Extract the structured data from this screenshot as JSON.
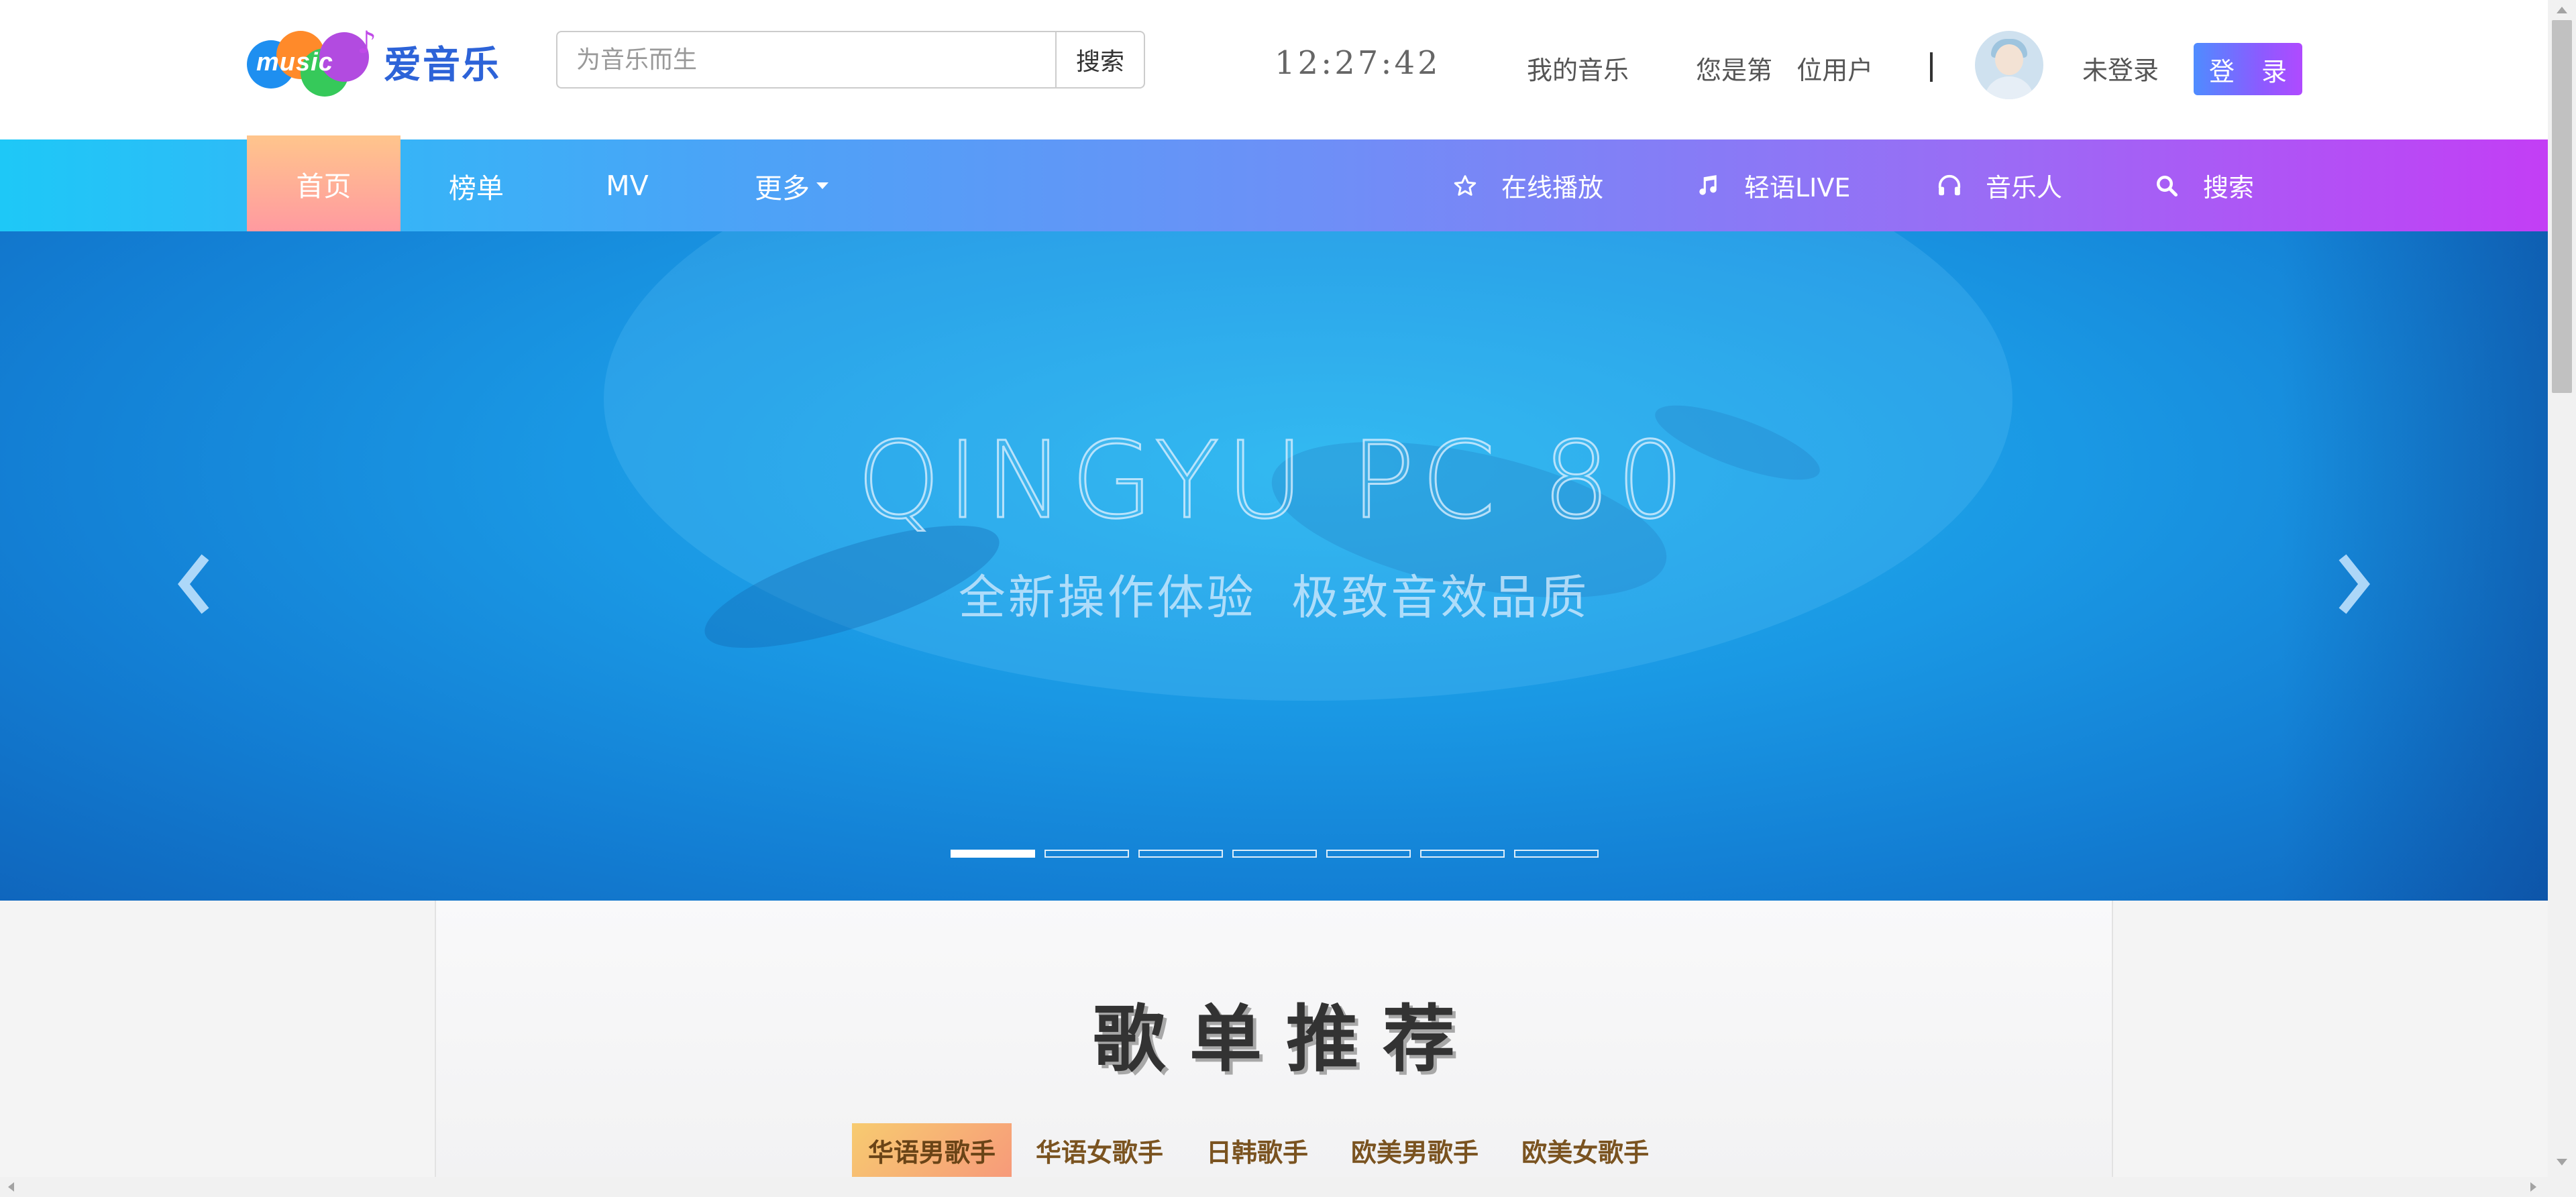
{
  "header": {
    "logo_word": "music",
    "logo_text": "爱音乐",
    "search": {
      "placeholder": "为音乐而生",
      "value": "",
      "button_label": "搜索"
    },
    "clock": "12:27:42",
    "my_music": "我的音乐",
    "visitor_text": "您是第   位用户",
    "login_status": "未登录",
    "login_button": "登 录"
  },
  "nav": {
    "left": [
      {
        "label": "首页",
        "active": true
      },
      {
        "label": "榜单"
      },
      {
        "label": "MV"
      },
      {
        "label": "更多"
      }
    ],
    "right": [
      {
        "label": "在线播放",
        "icon": "star-icon"
      },
      {
        "label": "轻语LIVE",
        "icon": "music-note-icon"
      },
      {
        "label": "音乐人",
        "icon": "headphones-icon"
      },
      {
        "label": "搜索",
        "icon": "search-icon"
      }
    ],
    "active_gradient": [
      "#ffc58c",
      "#ff9aa0"
    ]
  },
  "banner": {
    "title": "QINGYU PC 80",
    "subtitle": "全新操作体验  极致音效品质",
    "slide_count": 7,
    "active_slide": 1
  },
  "section": {
    "title": "歌单推荐",
    "tabs": [
      {
        "label": "华语男歌手",
        "active": true
      },
      {
        "label": "华语女歌手"
      },
      {
        "label": "日韩歌手"
      },
      {
        "label": "欧美男歌手"
      },
      {
        "label": "欧美女歌手"
      }
    ]
  },
  "colors": {
    "accent_blue": "#2d63d8",
    "nav_gradient_start": "#1ec8f7",
    "nav_gradient_end": "#c33ef5",
    "tab_text": "#7a5320"
  }
}
